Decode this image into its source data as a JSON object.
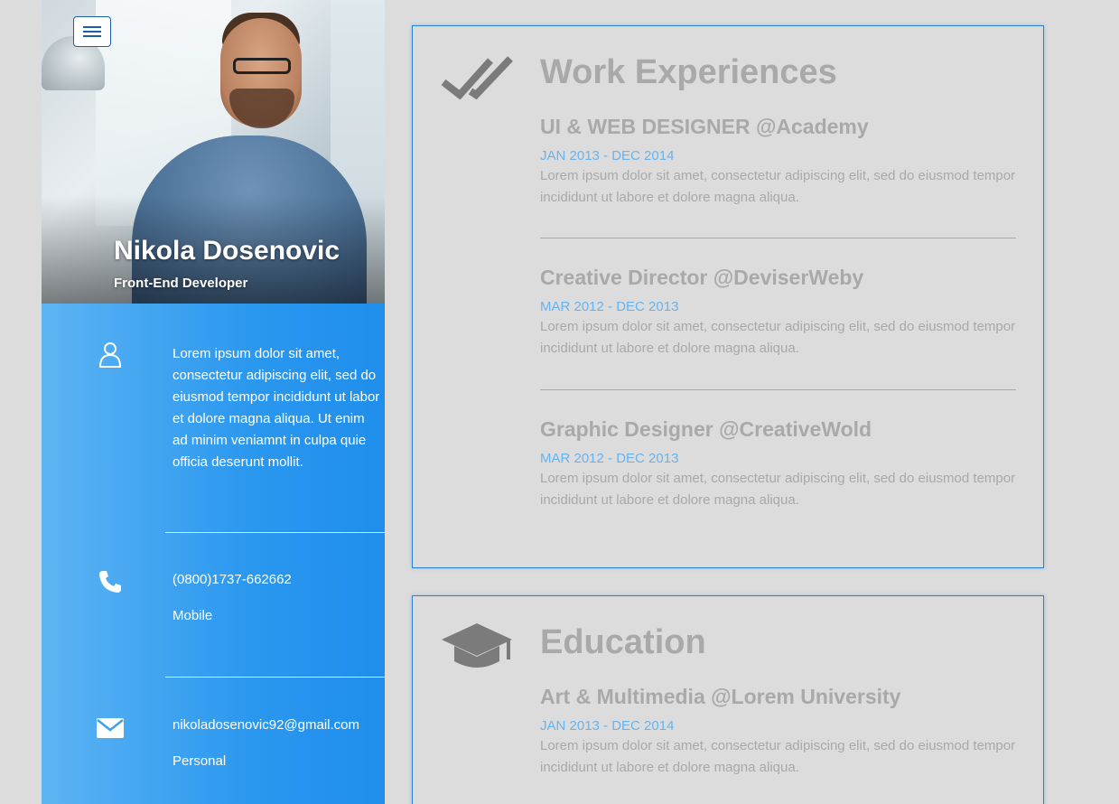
{
  "profile": {
    "name": "Nikola Dosenovic",
    "role": "Front-End Developer"
  },
  "contact": {
    "about": "Lorem ipsum dolor sit amet, consectetur adipiscing elit, sed do eiusmod tempor incididunt ut labor et dolore magna aliqua. Ut enim ad minim veniamnt in culpa quie officia deserunt mollit.",
    "phone": "(0800)1737-662662",
    "phone_label": "Mobile",
    "email": "nikoladosenovic92@gmail.com",
    "email_label": "Personal"
  },
  "work": {
    "title": "Work Experiences",
    "items": [
      {
        "title": "UI & WEB DESIGNER @Academy",
        "date": "JAN 2013 - DEC 2014",
        "desc": "Lorem ipsum dolor sit amet, consectetur adipiscing elit, sed do eiusmod tempor incididunt ut labore et dolore magna aliqua."
      },
      {
        "title": "Creative Director @DeviserWeby",
        "date": "MAR 2012 - DEC 2013",
        "desc": "Lorem ipsum dolor sit amet, consectetur adipiscing elit, sed do eiusmod tempor incididunt ut labore et dolore magna aliqua."
      },
      {
        "title": "Graphic Designer @CreativeWold",
        "date": "MAR 2012 - DEC 2013",
        "desc": "Lorem ipsum dolor sit amet, consectetur adipiscing elit, sed do eiusmod tempor incididunt ut labore et dolore magna aliqua."
      }
    ]
  },
  "education": {
    "title": "Education",
    "items": [
      {
        "title": "Art & Multimedia @Lorem University",
        "date": "JAN 2013 - DEC 2014",
        "desc": "Lorem ipsum dolor sit amet, consectetur adipiscing elit, sed do eiusmod tempor incididunt ut labore et dolore magna aliqua."
      }
    ]
  },
  "icons": {
    "menu": "hamburger-menu-icon",
    "about": "user-icon",
    "phone": "phone-icon",
    "email": "envelope-icon",
    "work": "double-check-icon",
    "education": "graduation-cap-icon"
  },
  "colors": {
    "accent": "#2b98ef",
    "date": "#66b4ef",
    "muted_text": "#a9a9a9",
    "background": "#dcdcdc",
    "card_border": "#2b7fd6"
  }
}
